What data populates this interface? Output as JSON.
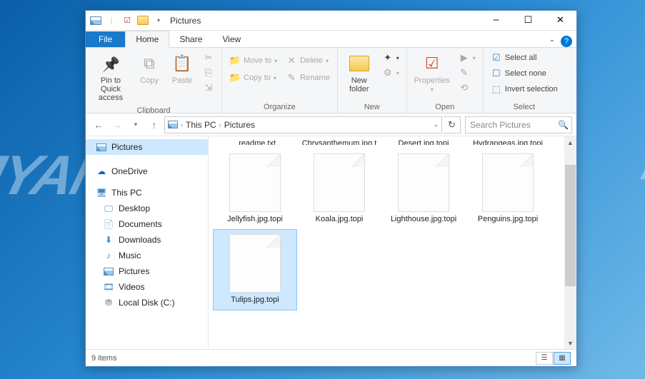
{
  "window": {
    "title": "Pictures"
  },
  "tabs": {
    "file": "File",
    "home": "Home",
    "share": "Share",
    "view": "View"
  },
  "ribbon": {
    "pin": "Pin to Quick access",
    "copy": "Copy",
    "paste": "Paste",
    "clipboard_label": "Clipboard",
    "moveto": "Move to",
    "copyto": "Copy to",
    "delete": "Delete",
    "rename": "Rename",
    "organize_label": "Organize",
    "newfolder": "New folder",
    "new_label": "New",
    "properties": "Properties",
    "open_label": "Open",
    "selectall": "Select all",
    "selectnone": "Select none",
    "invert": "Invert selection",
    "select_label": "Select"
  },
  "breadcrumb": {
    "thispc": "This PC",
    "pictures": "Pictures"
  },
  "search": {
    "placeholder": "Search Pictures"
  },
  "nav": {
    "pictures": "Pictures",
    "onedrive": "OneDrive",
    "thispc": "This PC",
    "desktop": "Desktop",
    "documents": "Documents",
    "downloads": "Downloads",
    "music": "Music",
    "pictures2": "Pictures",
    "videos": "Videos",
    "localdisk": "Local Disk (C:)"
  },
  "files": {
    "row0": [
      "_readme.txt",
      "Chrysanthemum.jpg.topi",
      "Desert.jpg.topi",
      "Hydrangeas.jpg.topi"
    ],
    "row1": [
      "Jellyfish.jpg.topi",
      "Koala.jpg.topi",
      "Lighthouse.jpg.topi",
      "Penguins.jpg.topi"
    ],
    "row2": [
      "Tulips.jpg.topi"
    ]
  },
  "status": {
    "count": "9 items"
  }
}
